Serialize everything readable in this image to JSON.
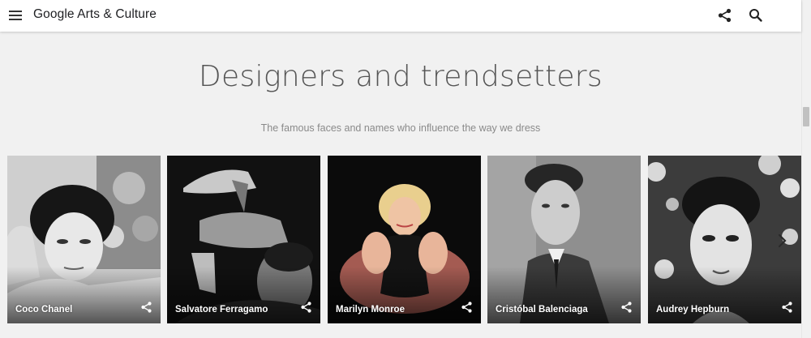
{
  "header": {
    "brand": "Google Arts & Culture",
    "icons": [
      "menu-icon",
      "share-icon",
      "search-icon"
    ]
  },
  "section": {
    "title": "Designers and trendsetters",
    "subtitle": "The famous faces and names who influence the way we dress"
  },
  "cards": [
    {
      "name": "Coco Chanel"
    },
    {
      "name": "Salvatore Ferragamo"
    },
    {
      "name": "Marilyn Monroe"
    },
    {
      "name": "Cristóbal Balenciaga"
    },
    {
      "name": "Audrey Hepburn"
    }
  ],
  "colors": {
    "page_background": "#f1f1f1",
    "header_background": "#ffffff",
    "title_text": "#555555",
    "subtitle_text": "#8a8a8a"
  }
}
